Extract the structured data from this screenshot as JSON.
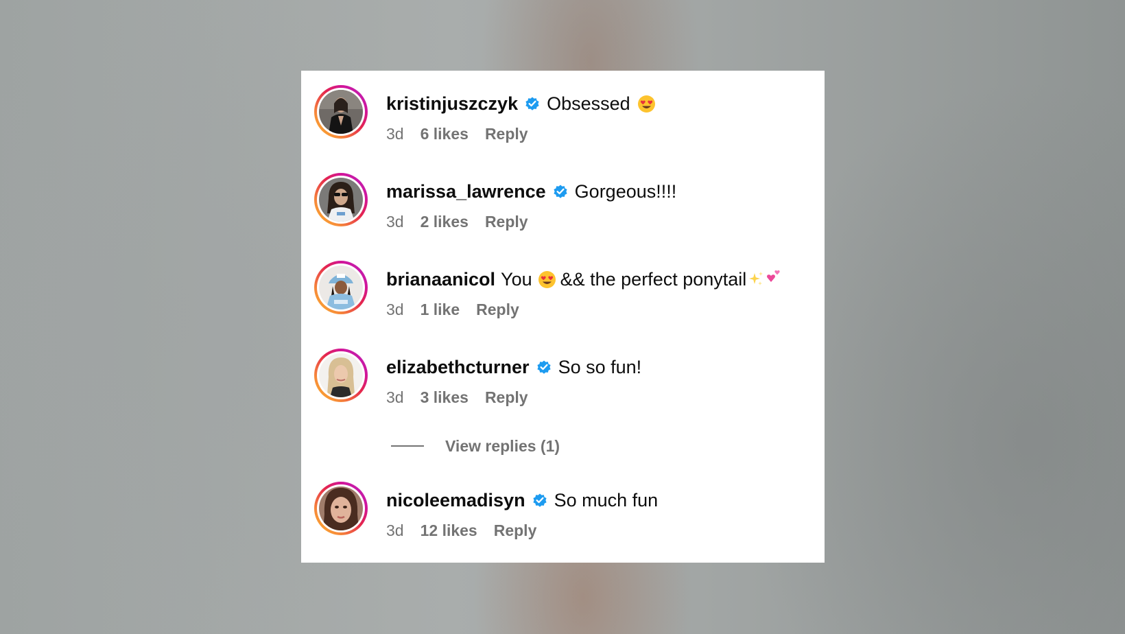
{
  "colors": {
    "verified_badge": "#1d9bf0",
    "username_text": "#0d0d0d",
    "meta_text": "#737373",
    "card_background": "#ffffff",
    "story_ring_start": "#fdb82b",
    "story_ring_end": "#b42ac1"
  },
  "comments": [
    {
      "username": "kristinjuszczyk",
      "verified": true,
      "text": "Obsessed",
      "trailing_emoji": "heart-eyes-emoji",
      "time": "3d",
      "likes": "6 likes",
      "reply_label": "Reply"
    },
    {
      "username": "marissa_lawrence",
      "verified": true,
      "text": "Gorgeous!!!!",
      "time": "3d",
      "likes": "2 likes",
      "reply_label": "Reply"
    },
    {
      "username": "brianaanicol",
      "verified": false,
      "text_before_emoji": "You",
      "inline_emoji": "heart-eyes-emoji",
      "text_after_emoji": "&& the perfect ponytail",
      "trailing_emojis": [
        "sparkles-emoji",
        "two-hearts-emoji"
      ],
      "time": "3d",
      "likes": "1 like",
      "reply_label": "Reply"
    },
    {
      "username": "elizabethcturner",
      "verified": true,
      "text": "So so fun!",
      "time": "3d",
      "likes": "3 likes",
      "reply_label": "Reply"
    },
    {
      "username": "nicoleemadisyn",
      "verified": true,
      "text": "So much fun",
      "time": "3d",
      "likes": "12 likes",
      "reply_label": "Reply"
    }
  ],
  "view_replies_label": "View replies (1)"
}
